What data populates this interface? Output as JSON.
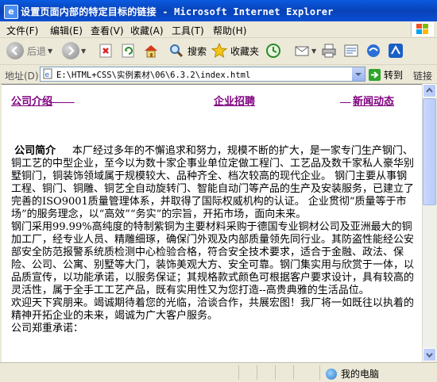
{
  "window": {
    "title": "设置页面内部的特定目标的链接 - Microsoft Internet Explorer"
  },
  "menu": {
    "items": [
      "文件(F)",
      "编辑(E)",
      "查看(V)",
      "收藏(A)",
      "工具(T)",
      "帮助(H)"
    ]
  },
  "toolbar": {
    "back_label": "后退",
    "search_label": "搜索",
    "favorites_label": "收藏夹"
  },
  "address": {
    "label": "地址(D)",
    "url": "E:\\HTML+CSS\\实例素材\\06\\6.3.2\\index.html",
    "go_label": "转到",
    "links_label": "链接"
  },
  "page": {
    "nav": [
      "公司介绍",
      "企业招聘",
      "新闻动态"
    ],
    "intro_heading": "公司简介",
    "intro_text": "本厂经过多年的不懈追求和努力，规模不断的扩大，是一家专门生产钢门、铜工艺的中型企业，至今以为数十家企事业单位定做工程门、工艺品及数千家私人豪华别墅铜门，铜装饰领域属于规模较大、品种齐全、档次较高的现代企业。 钢门主要从事钢工程、铜门、铜雕、铜艺全自动旋转门、智能自动门等产品的生产及安装服务，已建立了完善的ISO9001质量管理体系，并取得了国际权威机构的认证。 企业贯彻“质量等于市场”的服务理念，以“高效”“务实”的宗旨，开拓市场，面向未来。",
    "para2": "钢门采用99.99%高纯度的特制紫铜为主要材料采购于德国专业铜材公司及亚洲最大的铜加工厂，经专业人员、精雕细琢，确保门外观及内部质量领先同行业。其防盗性能经公安部安全防范报警系统质检测中心检验合格，符合安全技术要求，适合于金融、政法、保险、公司、公寓、别墅等大门，装饰美观大方、安全可靠。钢门集实用与欣赏于一体，以品质宣传，以功能承诺，以服务保证；其规格款式颜色可根据客户要求设计，具有较高的灵活性，属于全手工工艺产品，既有实用性又为您打造--高贵典雅的生活品位。",
    "para3": "欢迎天下宾朋来。竭诚期待着您的光临，洽谈合作，共展宏图！我厂将一如既往以执着的精神开拓企业的未来，竭诚为广大客户服务。",
    "para4": "公司郑重承诺："
  },
  "status": {
    "zone": "我的电脑"
  },
  "colors": {
    "titlebar": "#0a4fd4",
    "visited_link": "#800080"
  }
}
